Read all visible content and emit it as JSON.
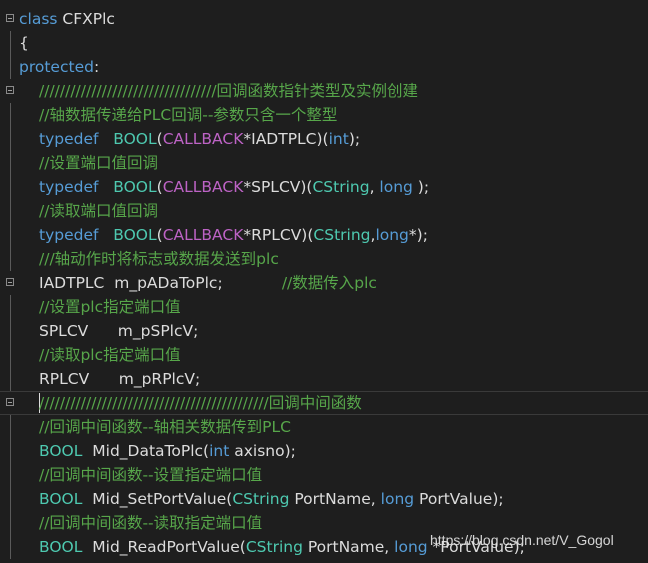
{
  "editor": {
    "colors": {
      "background": "#1e1e1e",
      "keyword": "#569cd6",
      "type": "#4ec9b0",
      "macro": "#bd63c5",
      "comment": "#57a64a",
      "text": "#dcdcdc"
    },
    "lines": [
      {
        "fold": true,
        "guide": false,
        "level": 0,
        "tokens": [
          {
            "t": "kw",
            "v": "class"
          },
          {
            "t": "id",
            "v": " CFXPlc"
          }
        ]
      },
      {
        "fold": false,
        "guide": true,
        "level": 0,
        "tokens": [
          {
            "t": "id",
            "v": "{"
          }
        ]
      },
      {
        "fold": false,
        "guide": true,
        "level": 0,
        "tokens": [
          {
            "t": "kw",
            "v": "protected"
          },
          {
            "t": "id",
            "v": ":"
          }
        ]
      },
      {
        "fold": true,
        "guide": false,
        "level": 1,
        "tokens": [
          {
            "t": "cm",
            "v": "//////////////////////////////////回调函数指针类型及实例创建"
          }
        ]
      },
      {
        "fold": false,
        "guide": true,
        "level": 1,
        "tokens": [
          {
            "t": "cm",
            "v": "//轴数据传递给PLC回调--参数只含一个整型"
          }
        ]
      },
      {
        "fold": false,
        "guide": true,
        "level": 1,
        "tokens": [
          {
            "t": "kw",
            "v": "typedef"
          },
          {
            "t": "id",
            "v": "   "
          },
          {
            "t": "ty",
            "v": "BOOL"
          },
          {
            "t": "id",
            "v": "("
          },
          {
            "t": "mac",
            "v": "CALLBACK"
          },
          {
            "t": "id",
            "v": "*IADTPLC)("
          },
          {
            "t": "kw",
            "v": "int"
          },
          {
            "t": "id",
            "v": ");"
          }
        ]
      },
      {
        "fold": false,
        "guide": true,
        "level": 1,
        "tokens": [
          {
            "t": "cm",
            "v": "//设置端口值回调"
          }
        ]
      },
      {
        "fold": false,
        "guide": true,
        "level": 1,
        "tokens": [
          {
            "t": "kw",
            "v": "typedef"
          },
          {
            "t": "id",
            "v": "   "
          },
          {
            "t": "ty",
            "v": "BOOL"
          },
          {
            "t": "id",
            "v": "("
          },
          {
            "t": "mac",
            "v": "CALLBACK"
          },
          {
            "t": "id",
            "v": "*SPLCV)("
          },
          {
            "t": "ty",
            "v": "CString"
          },
          {
            "t": "id",
            "v": ", "
          },
          {
            "t": "kw",
            "v": "long"
          },
          {
            "t": "id",
            "v": " );"
          }
        ]
      },
      {
        "fold": false,
        "guide": true,
        "level": 1,
        "tokens": [
          {
            "t": "cm",
            "v": "//读取端口值回调"
          }
        ]
      },
      {
        "fold": false,
        "guide": true,
        "level": 1,
        "tokens": [
          {
            "t": "kw",
            "v": "typedef"
          },
          {
            "t": "id",
            "v": "   "
          },
          {
            "t": "ty",
            "v": "BOOL"
          },
          {
            "t": "id",
            "v": "("
          },
          {
            "t": "mac",
            "v": "CALLBACK"
          },
          {
            "t": "id",
            "v": "*RPLCV)("
          },
          {
            "t": "ty",
            "v": "CString"
          },
          {
            "t": "id",
            "v": ","
          },
          {
            "t": "kw",
            "v": "long"
          },
          {
            "t": "id",
            "v": "*);"
          }
        ]
      },
      {
        "fold": false,
        "guide": true,
        "level": 1,
        "tokens": [
          {
            "t": "cm",
            "v": "///轴动作时将标志或数据发送到plc"
          }
        ]
      },
      {
        "fold": true,
        "guide": false,
        "level": 1,
        "tokens": [
          {
            "t": "id",
            "v": "IADTPLC  m_pADaToPlc;            "
          },
          {
            "t": "cm",
            "v": "//数据传入plc"
          }
        ]
      },
      {
        "fold": false,
        "guide": true,
        "level": 1,
        "tokens": [
          {
            "t": "cm",
            "v": "//设置plc指定端口值"
          }
        ]
      },
      {
        "fold": false,
        "guide": true,
        "level": 1,
        "tokens": [
          {
            "t": "id",
            "v": "SPLCV      m_pSPlcV;"
          }
        ]
      },
      {
        "fold": false,
        "guide": true,
        "level": 1,
        "tokens": [
          {
            "t": "cm",
            "v": "//读取plc指定端口值"
          }
        ]
      },
      {
        "fold": false,
        "guide": true,
        "level": 1,
        "tokens": [
          {
            "t": "id",
            "v": "RPLCV      m_pRPlcV;"
          }
        ]
      },
      {
        "fold": true,
        "guide": false,
        "level": 1,
        "current": true,
        "tokens": [
          {
            "t": "cm",
            "v": "////////////////////////////////////////////回调中间函数"
          }
        ]
      },
      {
        "fold": false,
        "guide": true,
        "level": 1,
        "tokens": [
          {
            "t": "cm",
            "v": "//回调中间函数--轴相关数据传到PLC"
          }
        ]
      },
      {
        "fold": false,
        "guide": true,
        "level": 1,
        "tokens": [
          {
            "t": "ty",
            "v": "BOOL"
          },
          {
            "t": "id",
            "v": "  Mid_DataToPlc("
          },
          {
            "t": "kw",
            "v": "int"
          },
          {
            "t": "id",
            "v": " axisno);"
          }
        ]
      },
      {
        "fold": false,
        "guide": true,
        "level": 1,
        "tokens": [
          {
            "t": "cm",
            "v": "//回调中间函数--设置指定端口值"
          }
        ]
      },
      {
        "fold": false,
        "guide": true,
        "level": 1,
        "tokens": [
          {
            "t": "ty",
            "v": "BOOL"
          },
          {
            "t": "id",
            "v": "  Mid_SetPortValue("
          },
          {
            "t": "ty",
            "v": "CString"
          },
          {
            "t": "id",
            "v": " PortName, "
          },
          {
            "t": "kw",
            "v": "long"
          },
          {
            "t": "id",
            "v": " PortValue);"
          }
        ]
      },
      {
        "fold": false,
        "guide": true,
        "level": 1,
        "tokens": [
          {
            "t": "cm",
            "v": "//回调中间函数--读取指定端口值"
          }
        ]
      },
      {
        "fold": false,
        "guide": true,
        "level": 1,
        "tokens": [
          {
            "t": "ty",
            "v": "BOOL"
          },
          {
            "t": "id",
            "v": "  Mid_ReadPortValue("
          },
          {
            "t": "ty",
            "v": "CString"
          },
          {
            "t": "id",
            "v": " PortName, "
          },
          {
            "t": "kw",
            "v": "long"
          },
          {
            "t": "id",
            "v": " *PortValue);"
          }
        ]
      }
    ]
  },
  "watermark": {
    "text": "https://blog.csdn.net/V_Gogol"
  }
}
